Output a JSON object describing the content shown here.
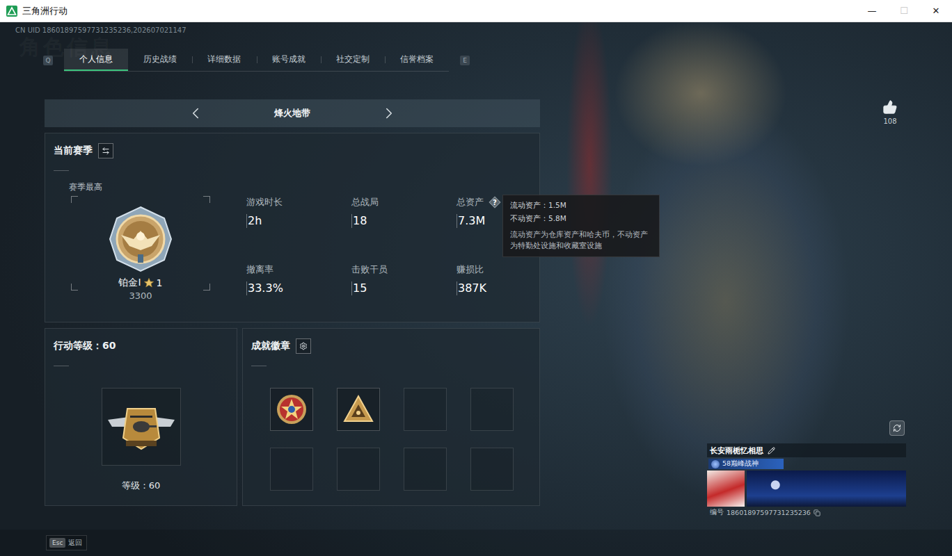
{
  "window": {
    "title": "三角洲行动",
    "controls": [
      {
        "label": "—",
        "disabled": false
      },
      {
        "label": "☐",
        "disabled": true
      },
      {
        "label": "✕",
        "disabled": false
      }
    ]
  },
  "uid_line": "CN UID 18601897597731235236,202607021147",
  "watermark": "角色信息",
  "tabs": {
    "prev_key": "Q",
    "next_key": "E",
    "items": [
      {
        "label": "个人信息",
        "selected": true
      },
      {
        "label": "历史战绩",
        "selected": false
      },
      {
        "label": "详细数据",
        "selected": false
      },
      {
        "label": "账号成就",
        "selected": false
      },
      {
        "label": "社交定制",
        "selected": false
      },
      {
        "label": "信誉档案",
        "selected": false
      }
    ]
  },
  "mode": {
    "label": "烽火地带"
  },
  "season": {
    "title": "当前赛季",
    "best_label": "赛季最高",
    "rank": "铂金Ⅰ",
    "rank_stars": "1",
    "score": "3300",
    "help_mark": "?",
    "stats": [
      {
        "label": "游戏时长",
        "value": "2h",
        "help": false
      },
      {
        "label": "总战局",
        "value": "18",
        "help": false
      },
      {
        "label": "总资产",
        "value": "7.3M",
        "help": true
      },
      {
        "label": "撤离率",
        "value": "33.3%",
        "help": false
      },
      {
        "label": "击败干员",
        "value": "15",
        "help": false
      },
      {
        "label": "赚损比",
        "value": "387K",
        "help": false
      }
    ]
  },
  "tooltip": {
    "lines": [
      "流动资产：1.5M",
      "不动资产：5.8M"
    ],
    "note": "流动资产为仓库资产和哈夫币，不动资产为特勤处设施和收藏室设施"
  },
  "level_panel": {
    "title": "行动等级：60",
    "caption": "等级：60"
  },
  "badges_panel": {
    "title": "成就徽章",
    "slots": [
      {
        "filled": true,
        "kind": "star"
      },
      {
        "filled": true,
        "kind": "triangle"
      },
      {
        "filled": false,
        "kind": "empty"
      },
      {
        "filled": false,
        "kind": "empty"
      },
      {
        "filled": false,
        "kind": "empty"
      },
      {
        "filled": false,
        "kind": "empty"
      },
      {
        "filled": false,
        "kind": "empty"
      },
      {
        "filled": false,
        "kind": "empty"
      }
    ]
  },
  "likes": {
    "count": "108"
  },
  "player": {
    "name": "长安雨栀忆相思",
    "title": "58巅峰战神",
    "id_label": "编号",
    "id": "18601897597731235236"
  },
  "footer": {
    "key": "Esc",
    "label": "返回"
  }
}
